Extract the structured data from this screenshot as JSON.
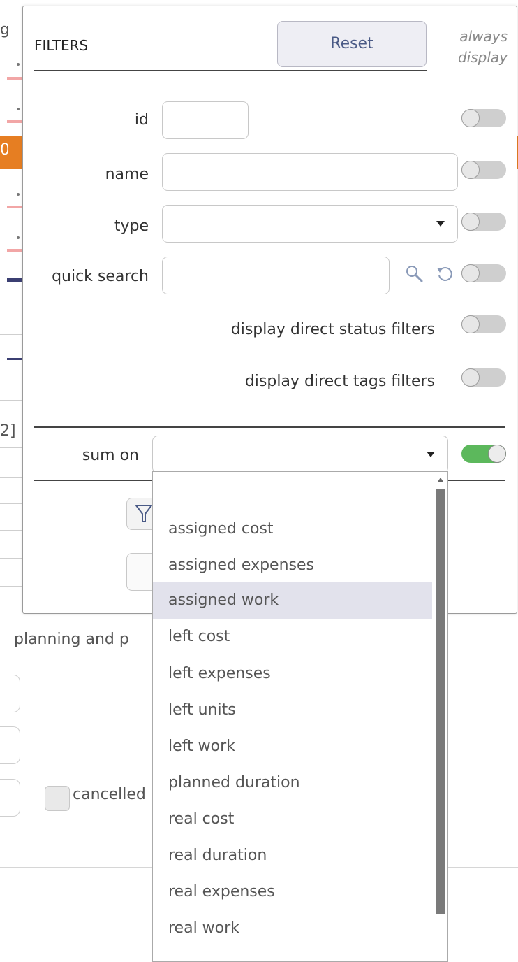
{
  "background": {
    "left_fragments": [
      "g",
      "0",
      "2]"
    ],
    "section_label": "planning and p",
    "cancelled_label": "cancelled"
  },
  "filters": {
    "title": "FILTERS",
    "reset_label": "Reset",
    "always_display_label": "always display",
    "rows": {
      "id": {
        "label": "id",
        "value": "",
        "always_display": false
      },
      "name": {
        "label": "name",
        "value": "",
        "always_display": false
      },
      "type": {
        "label": "type",
        "value": "",
        "always_display": false
      },
      "quick_search": {
        "label": "quick search",
        "value": "",
        "always_display": false
      },
      "status": {
        "label": "display direct status filters",
        "always_display": false
      },
      "tags": {
        "label": "display direct tags filters",
        "always_display": false
      }
    },
    "sum_on": {
      "label": "sum on",
      "value": "",
      "always_display": true,
      "options": [
        "",
        "assigned cost",
        "assigned expenses",
        "assigned work",
        "left cost",
        "left expenses",
        "left units",
        "left work",
        "planned duration",
        "real cost",
        "real duration",
        "real expenses",
        "real work"
      ],
      "highlighted_option": "assigned work"
    }
  },
  "colors": {
    "toggle_on": "#5cb85c",
    "toggle_off": "#cfcfcf",
    "reset_text": "#4a5a86",
    "accent_orange": "#e67e22",
    "accent_pink": "#f2a6a6",
    "accent_navy": "#3b3f72",
    "dropdown_highlight": "#e2e2ec"
  },
  "icons": [
    "search-icon",
    "reset-search-icon",
    "filter-icon",
    "chevron-down-icon"
  ]
}
